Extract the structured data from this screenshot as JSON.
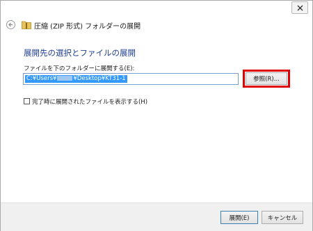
{
  "window": {
    "title": "圧縮 (ZIP 形式) フォルダーの展開"
  },
  "heading": "展開先の選択とファイルの展開",
  "destination": {
    "label": "ファイルを下のフォルダーに展開する(E):",
    "value_prefix": "C:¥Users¥",
    "value_suffix": "¥Desktop¥KT31-1",
    "browse_label": "参照(R)..."
  },
  "show_files_checkbox": {
    "label": "完了時に展開されたファイルを表示する(H)",
    "checked": false
  },
  "footer": {
    "extract_label": "展開(E)",
    "cancel_label": "キャンセル"
  },
  "colors": {
    "heading": "#1f3e8c",
    "selection": "#3399ff",
    "highlight": "#e00000"
  },
  "icons": {
    "back": "back-arrow-icon",
    "folder": "zip-folder-icon",
    "close": "close-icon"
  }
}
